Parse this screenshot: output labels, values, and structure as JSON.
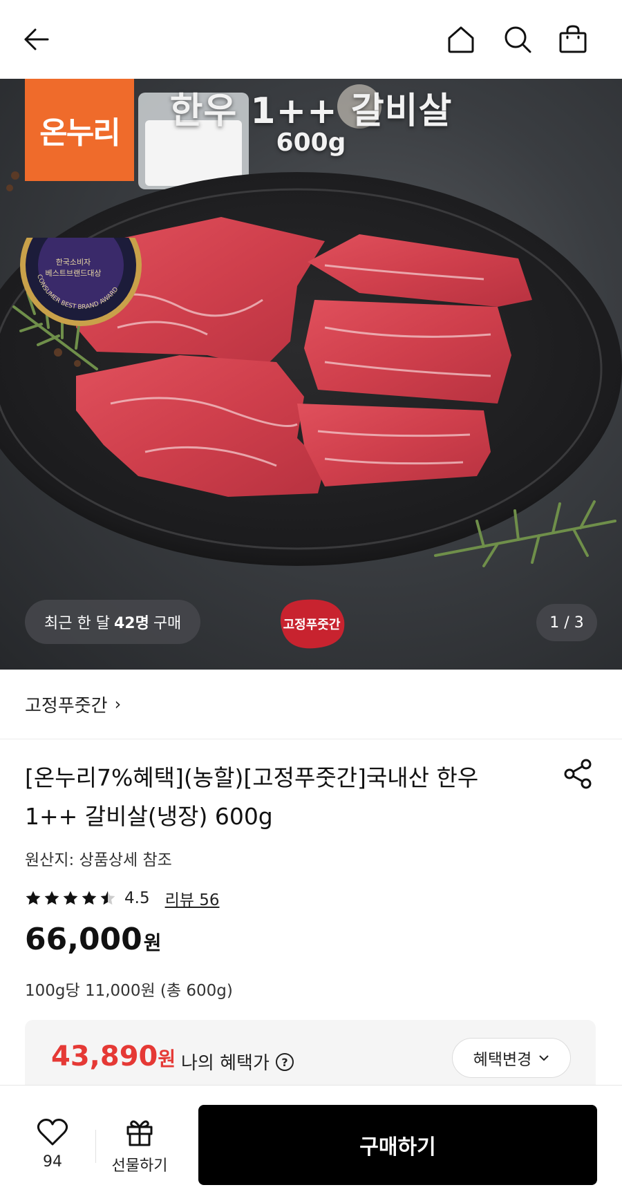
{
  "header": {
    "back_icon": "arrow-left-icon",
    "home_icon": "home-icon",
    "search_icon": "search-icon",
    "cart_icon": "shopping-bag-icon"
  },
  "hero": {
    "title_line1": "한우 1++ 갈비살",
    "title_line2": "600g",
    "brand_badge": "온누리",
    "award_line1": "한국소비자",
    "award_line2": "베스트브랜드대상",
    "award_ring": "CONSUMER BEST BRAND AWARD",
    "purchase_prefix": "최근 한 달",
    "purchase_count": "42명",
    "purchase_suffix": "구매",
    "seller_stamp": "고정푸줏간",
    "counter": "1 / 3"
  },
  "store": {
    "name": "고정푸줏간"
  },
  "product": {
    "title": "[온누리7%혜택](농할)[고정푸줏간]국내산 한우 1++ 갈비살(냉장) 600g",
    "origin": "원산지: 상품상세 참조",
    "rating": "4.5",
    "rating_value": 4.5,
    "review_link": "리뷰 56",
    "price": "66,000",
    "price_unit": "원",
    "unit_price": "100g당 11,000원 (총 600g)"
  },
  "benefit": {
    "price": "43,890",
    "price_unit": "원",
    "label": "나의 혜택가",
    "change_button": "혜택변경"
  },
  "bottom_bar": {
    "like_count": "94",
    "gift_label": "선물하기",
    "buy_label": "구매하기"
  },
  "colors": {
    "accent_red": "#e53935",
    "brand_orange": "#ef6b2b",
    "buy_button": "#000000"
  }
}
